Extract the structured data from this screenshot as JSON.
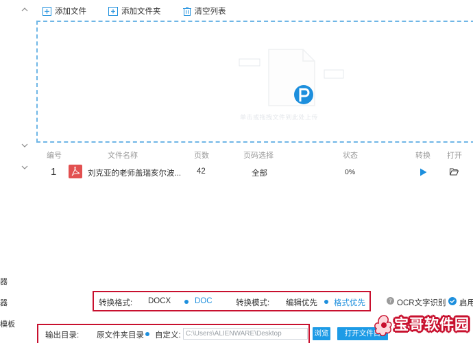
{
  "toolbar": {
    "add_file": "添加文件",
    "add_folder": "添加文件夹",
    "clear_list": "清空列表"
  },
  "dropzone": {
    "hint": "单击或拖拽文件到此处上传"
  },
  "sidebar": {
    "labels": [
      "器",
      "器",
      "模板"
    ]
  },
  "table": {
    "headers": {
      "index": "编号",
      "filename": "文件名称",
      "pages": "页数",
      "page_select": "页码选择",
      "status": "状态",
      "convert": "转换",
      "open": "打开"
    },
    "rows": [
      {
        "index": "1",
        "filename": "刘克亚的老师盖瑞亥尔波...",
        "pages": "42",
        "page_select": "全部",
        "status": "0%"
      }
    ]
  },
  "options": {
    "format_label": "转换格式:",
    "format_docx": "DOCX",
    "format_doc": "DOC",
    "mode_label": "转换模式:",
    "mode_edit": "编辑优先",
    "mode_format": "格式优先",
    "ocr": "OCR文字识别",
    "enable": "启用"
  },
  "output": {
    "label": "输出目录:",
    "original_folder": "原文件夹目录",
    "custom_label": "自定义:",
    "path": "C:\\Users\\ALIENWARE\\Desktop",
    "browse": "浏览",
    "open_folder": "打开文件目"
  },
  "watermark": {
    "text": "宝哥软件园"
  },
  "colors": {
    "accent": "#1d8fdd",
    "highlight_border": "#c8102e",
    "dashed_border": "#6fb6e6",
    "pdf_red": "#e25050"
  }
}
